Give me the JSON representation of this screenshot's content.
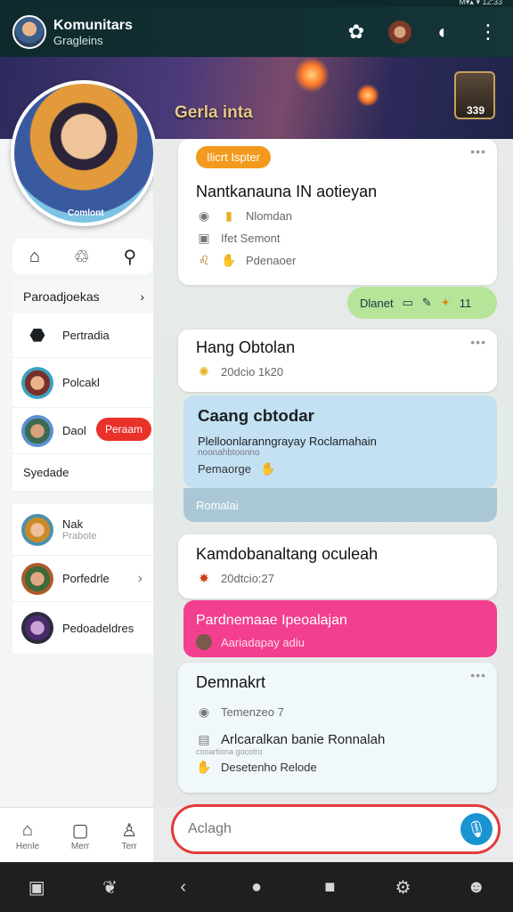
{
  "status": {
    "text": "M▾▴ ▾ 12:33"
  },
  "header": {
    "title": "Komunitars",
    "subtitle": "Gragleins"
  },
  "hero": {
    "title": "Gerla inta",
    "badge_count": "339"
  },
  "profile": {
    "name": "Comlont"
  },
  "sidebar": {
    "section_title": "Paroadjoekas",
    "items": [
      {
        "label": "Pertradia"
      },
      {
        "label": "Polcakl"
      },
      {
        "label": "Daol",
        "pill": "Peraam"
      }
    ],
    "group_label": "Syedade",
    "members": [
      {
        "label": "Nak",
        "sub": "Prabote"
      },
      {
        "label": "Porfedrle"
      },
      {
        "label": "Pedoadeldres"
      }
    ]
  },
  "bottom_tabs": [
    {
      "label": "Henle"
    },
    {
      "label": "Merr"
    },
    {
      "label": "Terr"
    }
  ],
  "feed": {
    "card1": {
      "tag": "Ilicrt Ispter",
      "title": "Nantkanauna IN aotieyan",
      "lines": [
        "Nlomdan",
        "Ifet Semont",
        "Pdenaoer"
      ]
    },
    "green_strip": {
      "label": "Dlanet",
      "count": "11"
    },
    "card2": {
      "title": "Hang Obtolan",
      "meta": "20dcio 1k20"
    },
    "blue": {
      "title": "Caang cbtodar",
      "body": "Plelloonlaranngrayay Roclamahain",
      "small": "noonahbtoonno",
      "meta": "Pemaorge",
      "footer": "Romalai"
    },
    "card3": {
      "title": "Kamdobanaltang oculeah",
      "meta": "20dtcio:27"
    },
    "pink": {
      "title": "Pardnemaae Ipeoalajan",
      "meta": "Aariadapay adiu"
    },
    "card4": {
      "title": "Demnakrt",
      "meta1": "Temenzeo 7",
      "line": "Arlcaralkan banie Ronnalah",
      "small": "cooartiona gocotro",
      "meta2": "Desetenho Relode"
    }
  },
  "input": {
    "placeholder": "Aclagh"
  },
  "colors": {
    "accent": "#1a93d1",
    "tag": "#f39a1e",
    "pink": "#f23f8e",
    "green": "#b6e59a",
    "danger": "#e23b3b"
  }
}
